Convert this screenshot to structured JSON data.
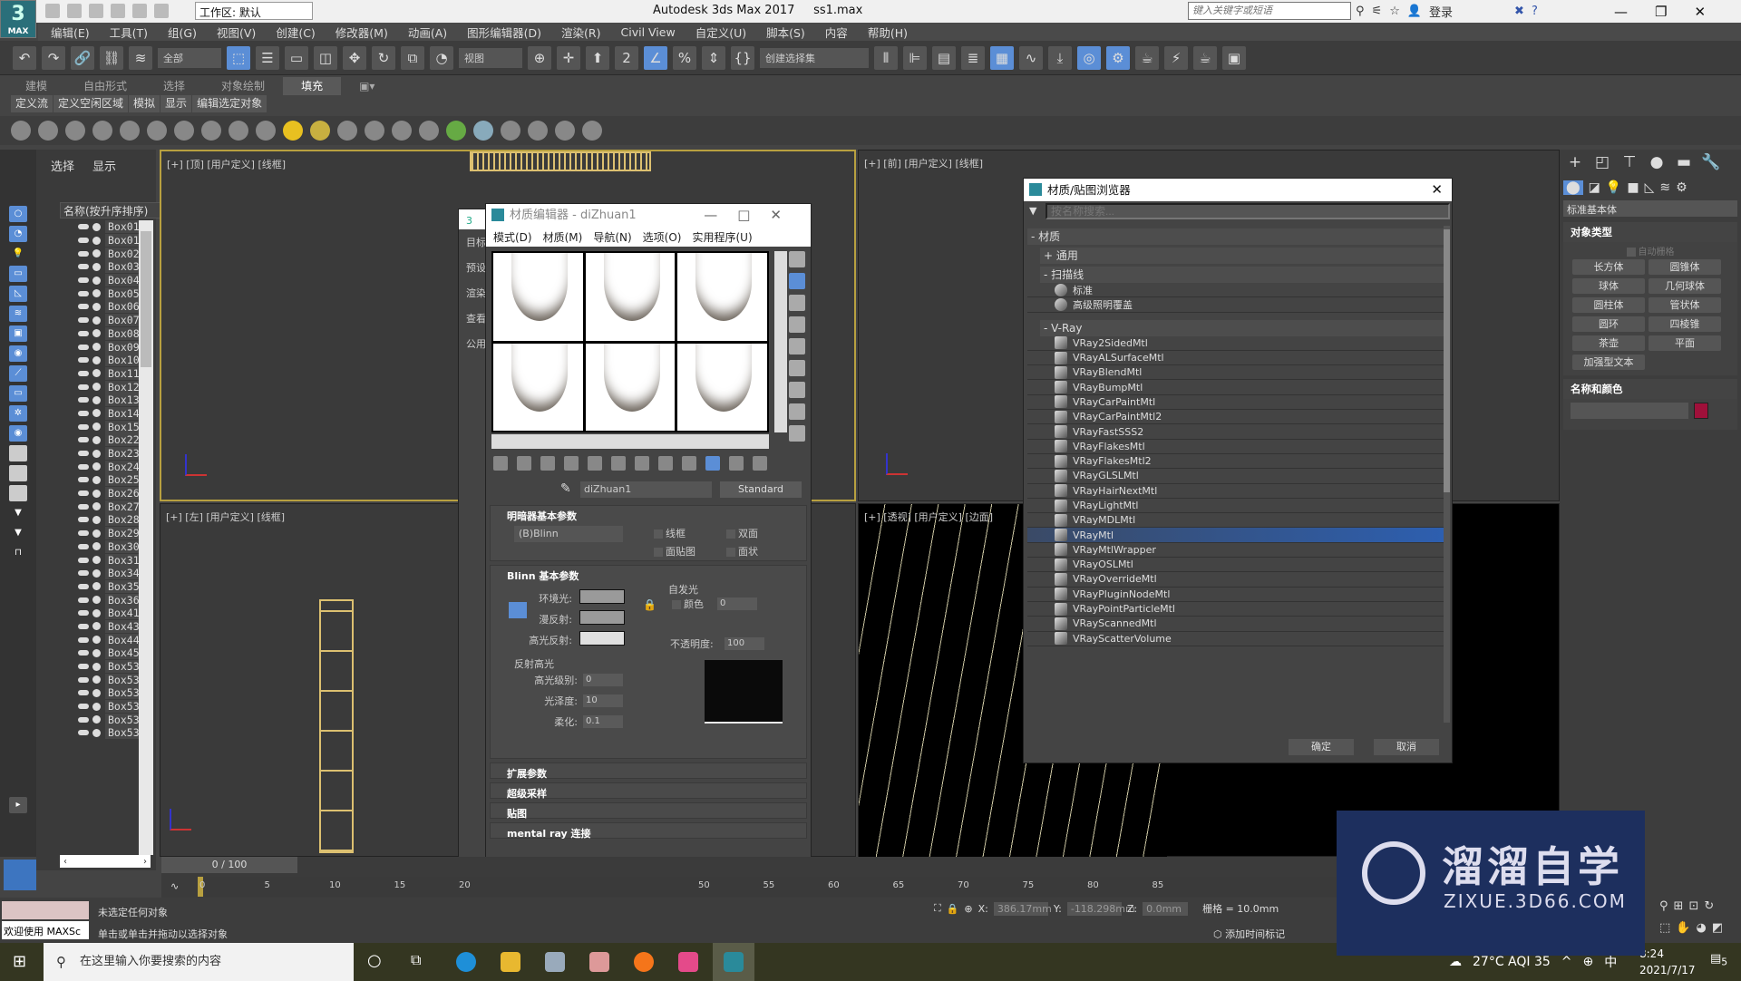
{
  "app": {
    "title": "Autodesk 3ds Max 2017",
    "file": "ss1.max",
    "logo": "3",
    "logo_sub": "MAX",
    "workspace": "工作区: 默认",
    "help_search_placeholder": "键入关键字或短语",
    "login": "登录"
  },
  "menu": [
    "编辑(E)",
    "工具(T)",
    "组(G)",
    "视图(V)",
    "创建(C)",
    "修改器(M)",
    "动画(A)",
    "图形编辑器(D)",
    "渲染(R)",
    "Civil View",
    "自定义(U)",
    "脚本(S)",
    "内容",
    "帮助(H)"
  ],
  "toolbar": {
    "filter": "全部",
    "ref_coord": "视图",
    "selection_set": "创建选择集"
  },
  "ribbon": {
    "tabs": [
      "建模",
      "自由形式",
      "选择",
      "对象绘制",
      "填充"
    ],
    "active": "填充",
    "subtabs": [
      "定义流",
      "定义空闲区域",
      "模拟",
      "显示",
      "编辑选定对象"
    ]
  },
  "explorer": {
    "tabs": [
      "选择",
      "显示"
    ],
    "header": "名称(按升序排序)",
    "objects": [
      "Box01",
      "Box01",
      "Box02",
      "Box03",
      "Box04",
      "Box05",
      "Box06",
      "Box07",
      "Box08",
      "Box09",
      "Box10",
      "Box11",
      "Box12",
      "Box13",
      "Box14",
      "Box15",
      "Box22",
      "Box23",
      "Box24",
      "Box25",
      "Box26",
      "Box27",
      "Box28",
      "Box29",
      "Box30",
      "Box31",
      "Box34",
      "Box35",
      "Box36",
      "Box41",
      "Box43",
      "Box44",
      "Box45",
      "Box53",
      "Box53",
      "Box53",
      "Box53",
      "Box53",
      "Box53"
    ]
  },
  "viewports": {
    "top": "[+] [顶] [用户定义] [线框]",
    "front": "[+] [前] [用户定义] [线框]",
    "left": "[+] [左] [用户定义] [线框]",
    "persp": "[+] [透视] [用户定义] [边面]"
  },
  "material_editor": {
    "title": "材质编辑器 - diZhuan1",
    "menu": [
      "模式(D)",
      "材质(M)",
      "导航(N)",
      "选项(O)",
      "实用程序(U)"
    ],
    "material_name": "diZhuan1",
    "material_type": "Standard",
    "back_labels": [
      "目标",
      "预设",
      "渲染",
      "查看",
      "公用"
    ],
    "shader": {
      "header": "明暗器基本参数",
      "shader_type": "(B)Blinn",
      "wire": "线框",
      "two_sided": "双面",
      "face_map": "面贴图",
      "faceted": "面状"
    },
    "blinn": {
      "header": "Blinn 基本参数",
      "ambient": "环境光:",
      "diffuse": "漫反射:",
      "specular": "高光反射:",
      "self_illum": "自发光",
      "color": "颜色",
      "self_illum_value": "0",
      "opacity_label": "不透明度:",
      "opacity": "100",
      "spec_group": "反射高光",
      "spec_level_label": "高光级别:",
      "spec_level": "0",
      "gloss_label": "光泽度:",
      "gloss": "10",
      "soften_label": "柔化:",
      "soften": "0.1"
    },
    "rollouts": [
      "扩展参数",
      "超级采样",
      "贴图",
      "mental ray 连接"
    ]
  },
  "browser": {
    "title": "材质/贴图浏览器",
    "search_placeholder": "按名称搜索...",
    "group": "- 材质",
    "general": "+ 通用",
    "scanline": "- 扫描线",
    "scanline_items": [
      "标准",
      "高级照明覆盖"
    ],
    "vray": "- V-Ray",
    "vray_items": [
      "VRay2SidedMtl",
      "VRayALSurfaceMtl",
      "VRayBlendMtl",
      "VRayBumpMtl",
      "VRayCarPaintMtl",
      "VRayCarPaintMtl2",
      "VRayFastSSS2",
      "VRayFlakesMtl",
      "VRayFlakesMtl2",
      "VRayGLSLMtl",
      "VRayHairNextMtl",
      "VRayLightMtl",
      "VRayMDLMtl",
      "VRayMtl",
      "VRayMtlWrapper",
      "VRayOSLMtl",
      "VRayOverrideMtl",
      "VRayPluginNodeMtl",
      "VRayPointParticleMtl",
      "VRayScannedMtl",
      "VRayScatterVolume"
    ],
    "selected": "VRayMtl",
    "ok": "确定",
    "cancel": "取消"
  },
  "command_panel": {
    "category": "标准基本体",
    "object_type": "对象类型",
    "auto_grid": "自动栅格",
    "buttons": [
      "长方体",
      "圆锥体",
      "球体",
      "几何球体",
      "圆柱体",
      "管状体",
      "圆环",
      "四棱锥",
      "茶壶",
      "平面",
      "加强型文本"
    ],
    "name_color": "名称和颜色",
    "object_color": "#a0103a"
  },
  "timeline": {
    "position": "0 / 100",
    "ticks": [
      "0",
      "5",
      "10",
      "15",
      "20",
      "50",
      "55",
      "60",
      "65",
      "70",
      "75",
      "80",
      "85"
    ]
  },
  "status": {
    "maxscript": "欢迎使用 MAXSc",
    "line1": "未选定任何对象",
    "line2": "单击或单击并拖动以选择对象",
    "x": "386.17mm",
    "y": "-118.298mm",
    "z": "0.0mm",
    "grid": "栅格 = 10.0mm",
    "add_tag": "添加时间标记"
  },
  "taskbar": {
    "search": "在这里输入你要搜索的内容",
    "weather": "27°C AQI 35",
    "ime": "中",
    "time": "8:24",
    "date": "2021/7/17",
    "notifications": "5"
  },
  "watermark": {
    "cn": "溜溜自学",
    "url": "ZIXUE.3D66.COM"
  }
}
